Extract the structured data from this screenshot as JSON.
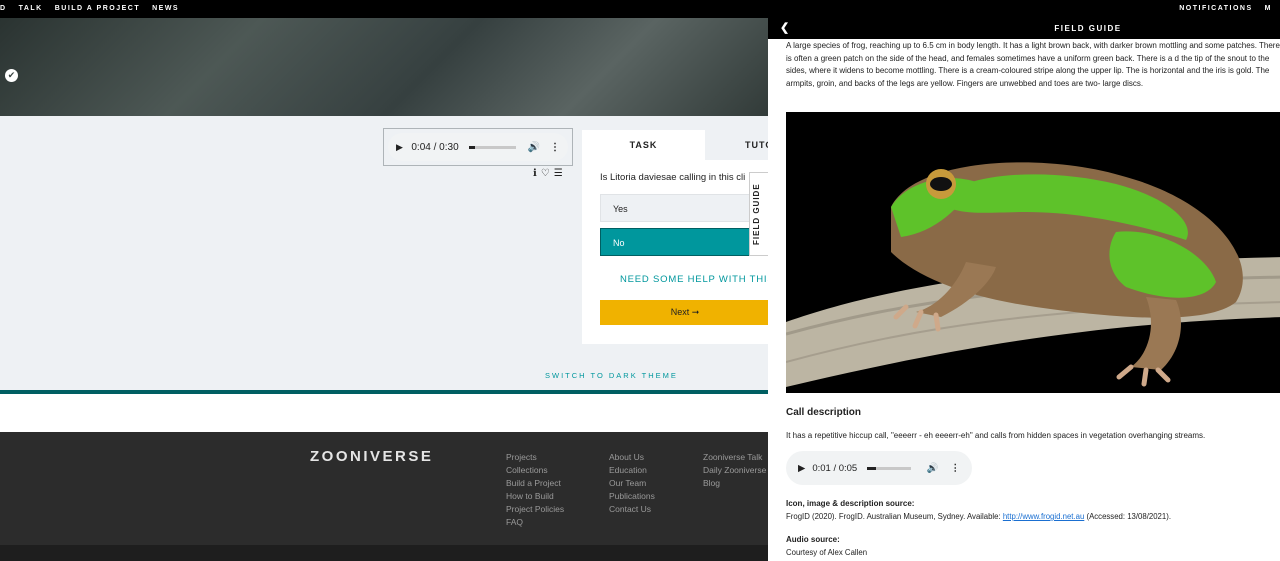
{
  "topnav": {
    "left_items": [
      "D",
      "TALK",
      "BUILD A PROJECT",
      "NEWS"
    ],
    "right_items": [
      "NOTIFICATIONS",
      "M"
    ]
  },
  "audio": {
    "time": "0:04 / 0:30",
    "progress": 0.13
  },
  "task": {
    "tabs": [
      "TASK",
      "TUTO"
    ],
    "question": "Is Litoria daviesae calling in this cli",
    "answers": [
      "Yes",
      "No"
    ],
    "selected": "No",
    "help": "NEED SOME HELP WITH THIS T",
    "next": "Next ➞"
  },
  "field_guide_tab": "FIELD GUIDE",
  "switch_theme": "SWITCH TO DARK THEME",
  "footer": {
    "logo": "ZOONIVERSE",
    "col1": [
      "Projects",
      "Collections",
      "Build a Project",
      "How to Build",
      "Project Policies",
      "FAQ"
    ],
    "col2": [
      "About Us",
      "Education",
      "Our Team",
      "Publications",
      "Contact Us"
    ],
    "col3": [
      "Zooniverse Talk",
      "Daily Zooniverse",
      "Blog"
    ]
  },
  "drawer": {
    "title": "FIELD GUIDE",
    "description": "A large species of frog, reaching up to 6.5 cm in body length. It has a light brown back, with darker brown mottling and some patches. There is often a green patch on the side of the head, and females sometimes have a uniform green back. There is a d the tip of the snout to the sides, where it widens to become mottling. There is a cream-coloured stripe along the upper lip. The is horizontal and the iris is gold. The armpits, groin, and backs of the legs are yellow. Fingers are unwebbed and toes are two- large discs.",
    "call_title": "Call description",
    "call_text": "It has a repetitive hiccup call, \"eeeerr - eh eeeerr-eh\" and calls from hidden spaces in vegetation overhanging streams.",
    "audio_time": "0:01 / 0:05",
    "audio_progress": 0.2,
    "icon_source_title": "Icon, image & description source:",
    "icon_source_pre": "FrogID (2020). FrogID. Australian Museum, Sydney. Available: ",
    "icon_source_link": "http://www.frogid.net.au",
    "icon_source_post": " (Accessed: 13/08/2021).",
    "audio_source_title": "Audio source:",
    "audio_source_text": "Courtesy of Alex Callen"
  },
  "colors": {
    "accent": "#00979d",
    "next_button": "#f0b200",
    "footer_bg": "#2c2c2c"
  }
}
